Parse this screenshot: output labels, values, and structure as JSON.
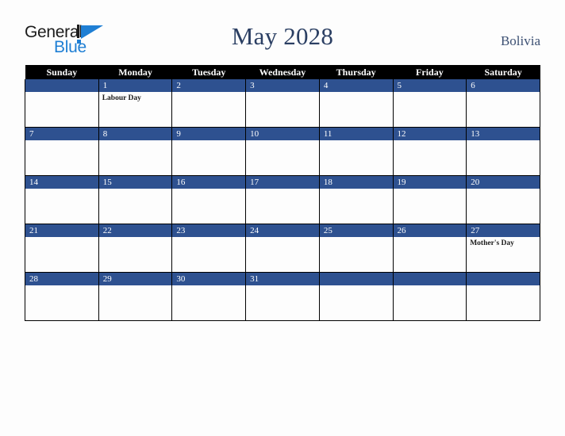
{
  "brand": {
    "name_part1": "General",
    "name_part2": "Blue",
    "logo_icon": "triangle-logo-icon",
    "color_dark": "#1c1c1c",
    "color_blue": "#1f7fd4"
  },
  "header": {
    "title": "May 2028",
    "country": "Bolivia",
    "title_color": "#2b3f63",
    "country_color": "#3c5073"
  },
  "calendar": {
    "month": "May",
    "year": "2028",
    "header_bg": "#000000",
    "daybar_bg": "#2e5190",
    "weekdays": [
      "Sunday",
      "Monday",
      "Tuesday",
      "Wednesday",
      "Thursday",
      "Friday",
      "Saturday"
    ],
    "weeks": [
      [
        {
          "day": "",
          "events": []
        },
        {
          "day": "1",
          "events": [
            "Labour Day"
          ]
        },
        {
          "day": "2",
          "events": []
        },
        {
          "day": "3",
          "events": []
        },
        {
          "day": "4",
          "events": []
        },
        {
          "day": "5",
          "events": []
        },
        {
          "day": "6",
          "events": []
        }
      ],
      [
        {
          "day": "7",
          "events": []
        },
        {
          "day": "8",
          "events": []
        },
        {
          "day": "9",
          "events": []
        },
        {
          "day": "10",
          "events": []
        },
        {
          "day": "11",
          "events": []
        },
        {
          "day": "12",
          "events": []
        },
        {
          "day": "13",
          "events": []
        }
      ],
      [
        {
          "day": "14",
          "events": []
        },
        {
          "day": "15",
          "events": []
        },
        {
          "day": "16",
          "events": []
        },
        {
          "day": "17",
          "events": []
        },
        {
          "day": "18",
          "events": []
        },
        {
          "day": "19",
          "events": []
        },
        {
          "day": "20",
          "events": []
        }
      ],
      [
        {
          "day": "21",
          "events": []
        },
        {
          "day": "22",
          "events": []
        },
        {
          "day": "23",
          "events": []
        },
        {
          "day": "24",
          "events": []
        },
        {
          "day": "25",
          "events": []
        },
        {
          "day": "26",
          "events": []
        },
        {
          "day": "27",
          "events": [
            "Mother's Day"
          ]
        }
      ],
      [
        {
          "day": "28",
          "events": []
        },
        {
          "day": "29",
          "events": []
        },
        {
          "day": "30",
          "events": []
        },
        {
          "day": "31",
          "events": []
        },
        {
          "day": "",
          "events": []
        },
        {
          "day": "",
          "events": []
        },
        {
          "day": "",
          "events": []
        }
      ]
    ]
  }
}
